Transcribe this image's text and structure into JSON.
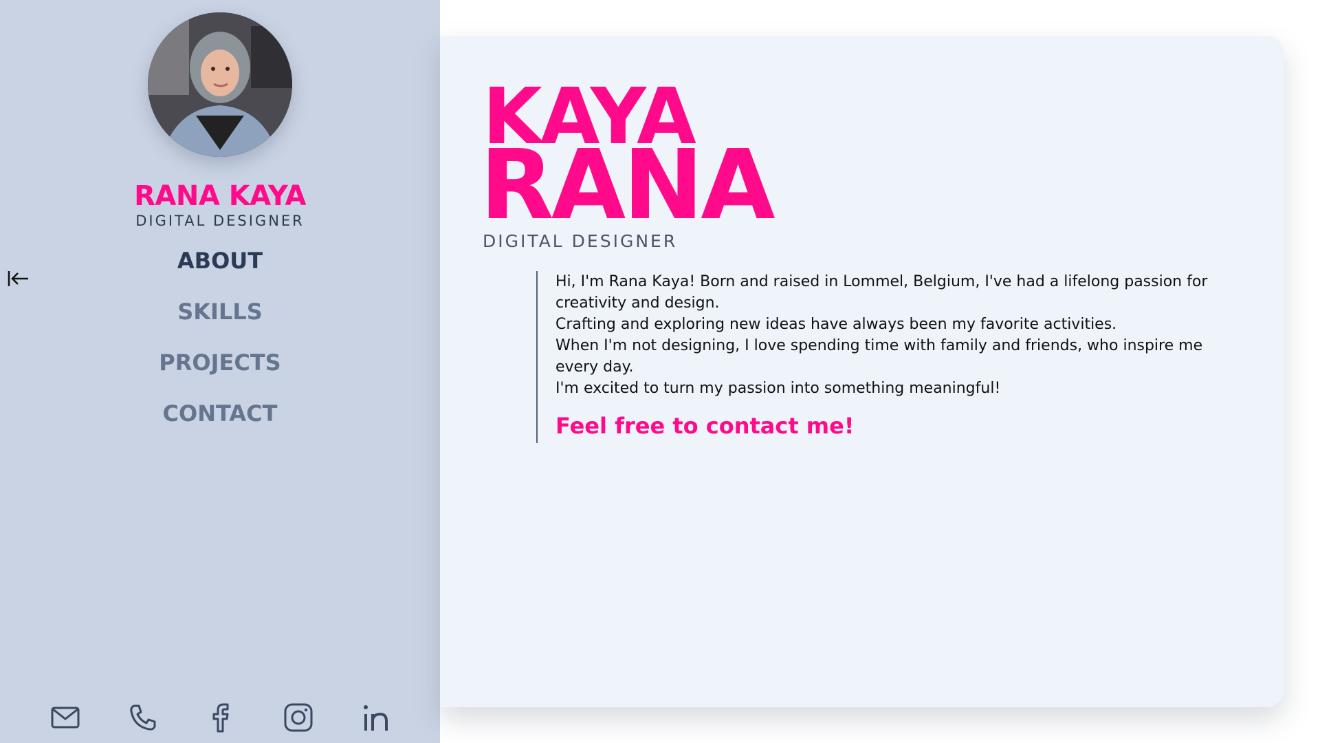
{
  "sidebar": {
    "name": "RANA KAYA",
    "role": "DIGITAL DESIGNER",
    "nav": [
      {
        "label": "ABOUT",
        "active": true
      },
      {
        "label": "SKILLS",
        "active": false
      },
      {
        "label": "PROJECTS",
        "active": false
      },
      {
        "label": "CONTACT",
        "active": false
      }
    ],
    "socials": [
      "mail-icon",
      "phone-icon",
      "facebook-icon",
      "instagram-icon",
      "linkedin-icon"
    ]
  },
  "main": {
    "last_name": "KAYA",
    "first_name": "RANA",
    "role": "DIGITAL DESIGNER",
    "about_lines": [
      "Hi, I'm Rana Kaya! Born and raised in Lommel, Belgium, I've had a lifelong passion for creativity and design.",
      "Crafting and exploring new ideas have always been my favorite activities.",
      "When I'm not designing, I love spending time with family and friends, who inspire me every day.",
      "I'm excited to turn my passion into something meaningful!"
    ],
    "cta": "Feel free to contact me!"
  },
  "colors": {
    "accent": "#ff0a8a",
    "sidebar_bg": "#c9d3e3",
    "card_bg": "#eff4fb",
    "nav_active": "#2b3a55",
    "nav_inactive": "#66758f"
  }
}
